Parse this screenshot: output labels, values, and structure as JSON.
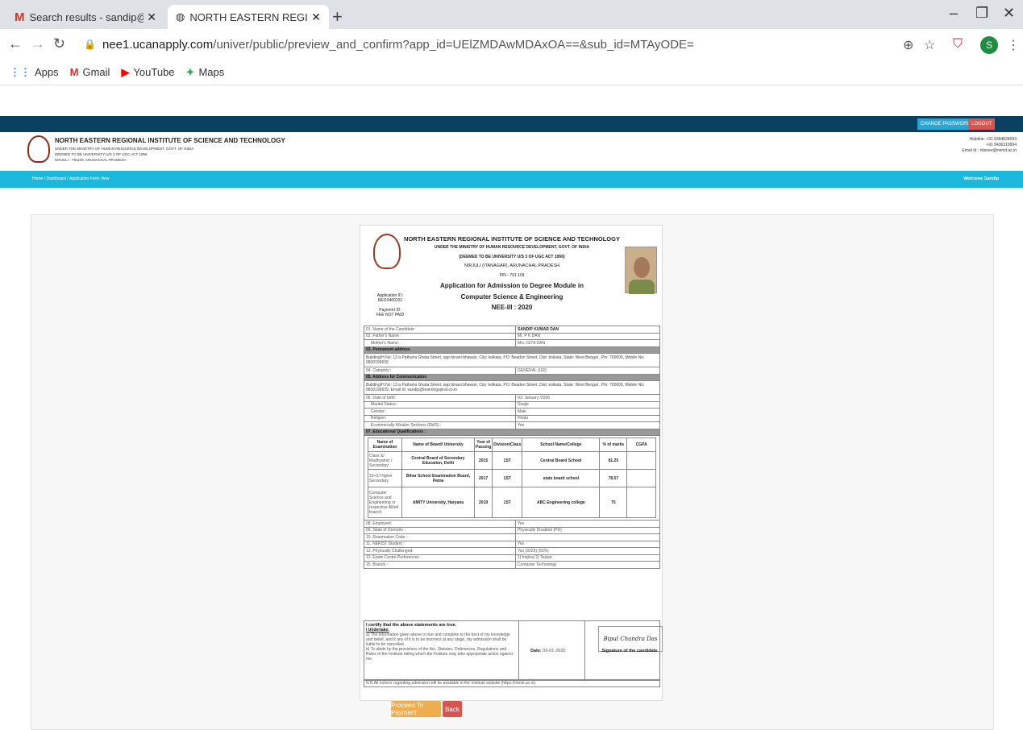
{
  "browser": {
    "tabs": [
      {
        "title": "Search results - sandip@learning",
        "icon": "gmail-icon"
      },
      {
        "title": "NORTH EASTERN REGIONAL INS",
        "icon": "globe-icon"
      }
    ],
    "new_tab": "+",
    "url_host": "nee1.ucanapply.com",
    "url_path": "/univer/public/preview_and_confirm?app_id=UElZMDAwMDAxOA==&sub_id=MTAyODE=",
    "profile_initial": "S",
    "bookmarks": [
      "Apps",
      "Gmail",
      "YouTube",
      "Maps"
    ]
  },
  "site": {
    "header_buttons": {
      "change_password": "CHANGE PASSWORD",
      "logout": "LOGOUT"
    },
    "title": "NORTH EASTERN REGIONAL INSTITUTE OF SCIENCE AND TECHNOLOGY",
    "sub_lines": [
      "UNDER THE MINISTRY OF HUMAN RESOURCE DEVELOPMENT, GOVT. OF INDIA",
      "DEEMED TO BE UNIVERSITY U/S 3 OF UGC ACT 1956",
      "NIRJULI - 791109, ARUNACHAL PRADESH"
    ],
    "contact": [
      "Helpline: +91 9394824093",
      "+91 9436319994",
      "Email Id : nitsnee@nerist.ac.in"
    ],
    "breadcrumb": "Home  /  Dashboard  /  Application Form View",
    "welcome": "Welcome Sandip"
  },
  "form": {
    "inst_name": "NORTH EASTERN REGIONAL INSTITUTE OF SCIENCE AND TECHNOLOGY",
    "inst_lines": [
      "UNDER THE MINISTRY OF HUMAN RESOURCE DEVELOPMENT, GOVT. OF INDIA",
      "(DEEMED TO BE UNIVERSITY U/S 3 OF UGC ACT 1956)",
      "NIRJULI (ITANAGAR), ARUNACHAL PRADESH",
      "PIN - 791 109"
    ],
    "app_title": [
      "Application for Admission to Degree Module in",
      "Computer Science & Engineering",
      "NEE-III : 2020"
    ],
    "application_id_label": "Application ID:",
    "application_id": "NEI19400231",
    "payment_id_label": "Payment ID:",
    "payment_id": "FEE NOT PAID",
    "rows_a": [
      {
        "label": "01. Name of the Candidate:",
        "value": "SANDIP KUMAR DAN"
      },
      {
        "label": "02. Father's Name :",
        "value": "Mr. P K DAN"
      },
      {
        "label": "Mother's Name:",
        "value": "Mrs. GITA DAN"
      }
    ],
    "permanent_header": "03. Permanent address",
    "permanent_address": "Building/H.No: 13 a Pathuria Ghata Street, opp binani bhawan, City: kolkata, PO: Beadon Street, Dist: kolkata, State: West Bengal , Pin: 700006, Mobile No: 9830199639",
    "category": {
      "label": "04. Category :",
      "value": "GENERAL (UR)"
    },
    "comm_header": "05. Address for Communication",
    "comm_address": "Building/H.No: 13 a Pathuria Ghata Street, opp binani bhawan, City: kolkata, PO: Beadon Street, Dist: kolkata, State: West Bengal , Pin: 700006, Mobile No: 9830199639, Email Id: sandip@learningspiral.co.in",
    "rows_b": [
      {
        "label": "06. Date of birth:",
        "value": "01/ January /2006"
      },
      {
        "label": "Marital Status:",
        "value": "Single"
      },
      {
        "label": "Gender:",
        "value": "Male"
      },
      {
        "label": "Religion:",
        "value": "Hindu"
      },
      {
        "label": "Economically Weaker Sections (EWS) :",
        "value": "Yes"
      }
    ],
    "edu_header": "07. Educational Qualifications :",
    "edu_columns": [
      "Name of Examination",
      "Name of Board/ University",
      "Year of Passing",
      "Division/Class",
      "School Name/College",
      "% of marks",
      "CGPA"
    ],
    "edu_rows": [
      [
        "Class X/ Madhyamic / Secondary",
        "Central Board of Secondary Education, Delhi",
        "2015",
        "1ST",
        "Central Board School",
        "81.25",
        ""
      ],
      [
        "10+2/ Higher Secondary",
        "Bihar School Examination Board, Patna",
        "2017",
        "1ST",
        "state board school",
        "78.57",
        ""
      ],
      [
        "Computer Science and Engineering or respective Allied branch",
        "AMITY University, Haryana",
        "2019",
        "1ST",
        "ABC Engineering college",
        "75",
        ""
      ]
    ],
    "rows_c": [
      {
        "label": "08. Employed:",
        "value": "Yes"
      },
      {
        "label": "09. State of Domicile :",
        "value": "Physically Disabled (PD)"
      },
      {
        "label": "10. Reservation Code :",
        "value": "-"
      },
      {
        "label": "11. NERIST Student :",
        "value": "Yes"
      },
      {
        "label": "12. Physically Challenged:",
        "value": "Yes (9229) (55%)"
      },
      {
        "label": "13. Exam Centre Preferences :",
        "value": "1) Imphal  2) Tezpur"
      },
      {
        "label": "15. Branch :",
        "value": "Computer Technology"
      }
    ],
    "certify": "I certify that the above statements are true.",
    "undertake": "I Undertake:",
    "undertake_a": "a) The information given above is true and complete to the best of my knowledge and belief, and if any of it is to be incorrect at any stage, my admission shall be liable to be cancelled.",
    "undertake_b": "b) To abide by the provisions of the Act, Statutes, Ordinances, Regulations and Rules of the Institute failing which the Institute may take appropriate action against me.",
    "date_label": "Date:",
    "date_value": "05-01-2020",
    "signature_text": "Bipul Chandra Das",
    "signature_label": "Signature of the candidate",
    "nb": "N.B.All notices regarding admission will be available in the Institute website (https://nerist.ac.in)."
  },
  "actions": {
    "proceed": "Proceed To Payment",
    "back": "Back"
  }
}
